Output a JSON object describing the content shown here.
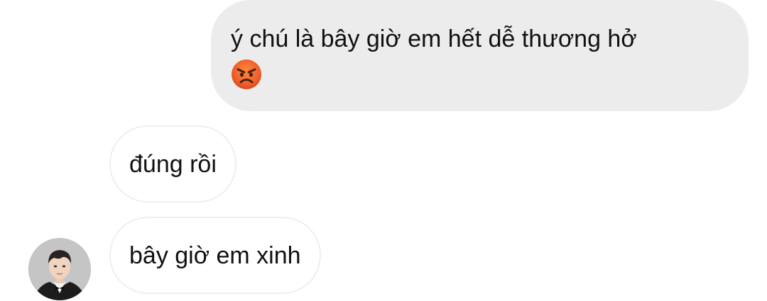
{
  "conversation": {
    "messages": [
      {
        "direction": "outgoing",
        "text": "ý chú là bây giờ em hết dễ thương hở",
        "emoji": "angry-face-emoji"
      },
      {
        "direction": "incoming",
        "text": "đúng rồi"
      },
      {
        "direction": "incoming",
        "text": "bây giờ em xinh",
        "avatar": "contact-avatar"
      }
    ]
  },
  "colors": {
    "outgoing_bubble": "#ececec",
    "incoming_bubble_border": "#efefef",
    "text": "#111111",
    "background": "#ffffff"
  }
}
